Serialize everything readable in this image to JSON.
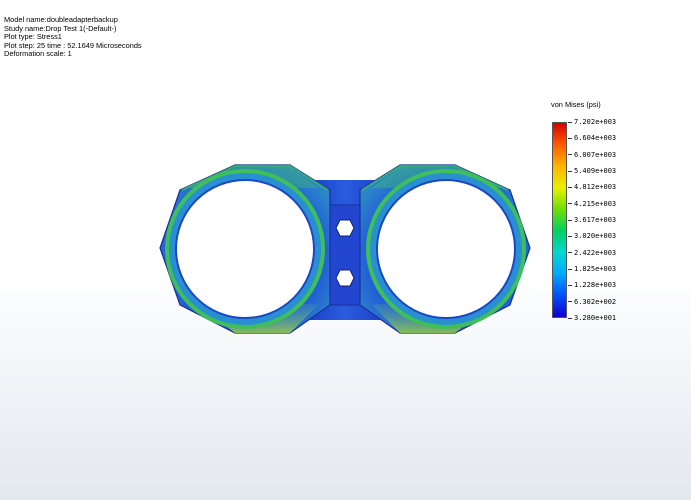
{
  "info": {
    "model_name": "Model name:doubleadapterbackup",
    "study_name": "Study name:Drop Test 1(-Default-)",
    "plot_type": "Plot type:  Stress1",
    "plot_step": "Plot step: 25   time : 52.1649 Microseconds",
    "deformation_scale": "Deformation scale: 1"
  },
  "legend": {
    "title": "von Mises (psi)",
    "ticks": [
      "7.202e+003",
      "6.604e+003",
      "6.007e+003",
      "5.409e+003",
      "4.812e+003",
      "4.215e+003",
      "3.617e+003",
      "3.020e+003",
      "2.422e+003",
      "1.825e+003",
      "1.228e+003",
      "6.302e+002",
      "3.280e+001"
    ],
    "colors": [
      "#d40000",
      "#ff5a00",
      "#ffb400",
      "#e8f000",
      "#6fe000",
      "#00d060",
      "#00d8d0",
      "#00a8ff",
      "#0050ff",
      "#1000d0"
    ]
  },
  "model": {
    "part_colors": {
      "body": "#1f4fd8",
      "body_dark": "#1030a8",
      "green_edge": "#3fb84a",
      "cyan_zone": "#25b9c8",
      "yellow_zone": "#b8d83a",
      "inner_ring": "#2a6ccc"
    }
  }
}
